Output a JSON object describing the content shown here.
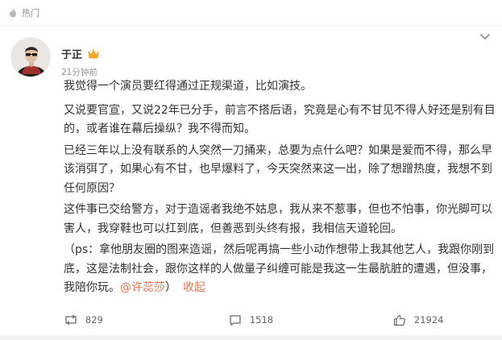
{
  "header": {
    "label": "热门"
  },
  "post": {
    "author": "于正",
    "time": "21分钟前",
    "paragraphs": [
      "我觉得一个演员要红得通过正规渠道，比如演技。",
      "又说要官宣，又说22年已分手，前言不搭后语，究竟是心有不甘见不得人好还是别有目的，或者谁在幕后操纵？我不得而知。",
      "已经三年以上没有联系的人突然一刀捅来，总要为点什么吧？如果是爱而不得，那么早该消弭了，如果心有不甘，也早爆料了，今天突然来这一出，除了想蹭热度，我想不到任何原因？",
      "这件事已交给警方，对于造谣者我绝不姑息，我从来不惹事，但也不怕事，你光脚可以害人，我穿鞋也可以扛到底，但善恶到头终有报，我相信天道轮回。",
      "（ps：拿他朋友圈的图来造谣，然后呢再搞一些小动作想带上我其他艺人，我跟你刚到底，这是法制社会，跟你这样的人做量子纠缠可能是我这一生最肮脏的遭遇，但没事，我陪你玩。"
    ],
    "mention": "@许蕊莎",
    "closing": "）",
    "collapse_label": "收起",
    "reposts": "829",
    "comments": "1518",
    "likes": "21924"
  },
  "colors": {
    "accent": "#eb7350",
    "muted": "#939393",
    "text": "#333333"
  },
  "icons": [
    "hot-icon",
    "more-icon",
    "vip-crown-icon",
    "repost-icon",
    "comment-icon",
    "like-icon"
  ]
}
